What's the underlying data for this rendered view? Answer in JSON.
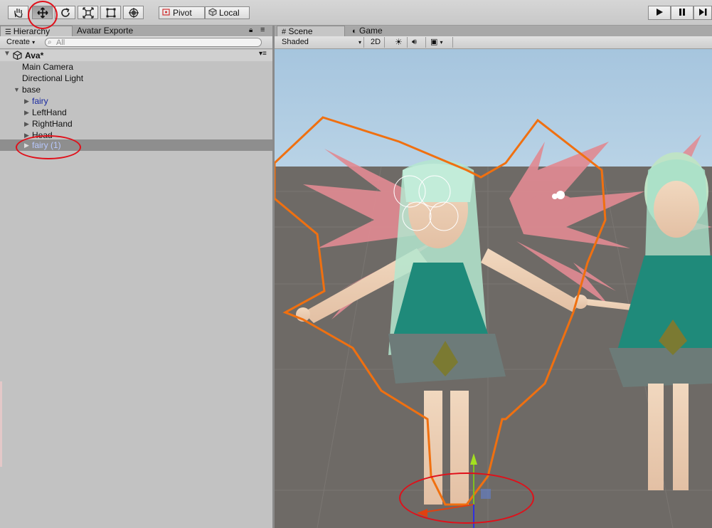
{
  "toolbar": {
    "tools": [
      {
        "name": "hand-tool",
        "icon": "hand-icon"
      },
      {
        "name": "move-tool",
        "icon": "move-icon"
      },
      {
        "name": "rotate-tool",
        "icon": "rotate-icon"
      },
      {
        "name": "scale-tool",
        "icon": "scale-icon"
      },
      {
        "name": "rect-tool",
        "icon": "rect-icon"
      },
      {
        "name": "transform-tool",
        "icon": "transform-icon"
      }
    ],
    "pivot_label": "Pivot",
    "local_label": "Local",
    "play_icons": [
      "play-icon",
      "pause-icon",
      "step-icon"
    ]
  },
  "hierarchy": {
    "tab_label": "Hierarchy",
    "second_tab_label": "Avatar Exporte",
    "create_label": "Create",
    "search_placeholder": "All",
    "scene_name": "Ava*",
    "items": [
      {
        "label": "Main Camera"
      },
      {
        "label": "Directional Light"
      },
      {
        "label": "base"
      },
      {
        "label": "fairy"
      },
      {
        "label": "LeftHand"
      },
      {
        "label": "RightHand"
      },
      {
        "label": "Head"
      },
      {
        "label": "fairy (1)"
      }
    ]
  },
  "scene": {
    "tab_label": "Scene",
    "game_tab_label": "Game",
    "shading_mode": "Shaded",
    "mode_2d_label": "2D"
  },
  "colors": {
    "annotation": "#e0101a",
    "selection_outline": "#f07010",
    "selected_row": "#8e8e8e",
    "prefab_blue": "#1a2aa0",
    "ground": "#6e6a66",
    "sky": "#a9c6dd"
  }
}
